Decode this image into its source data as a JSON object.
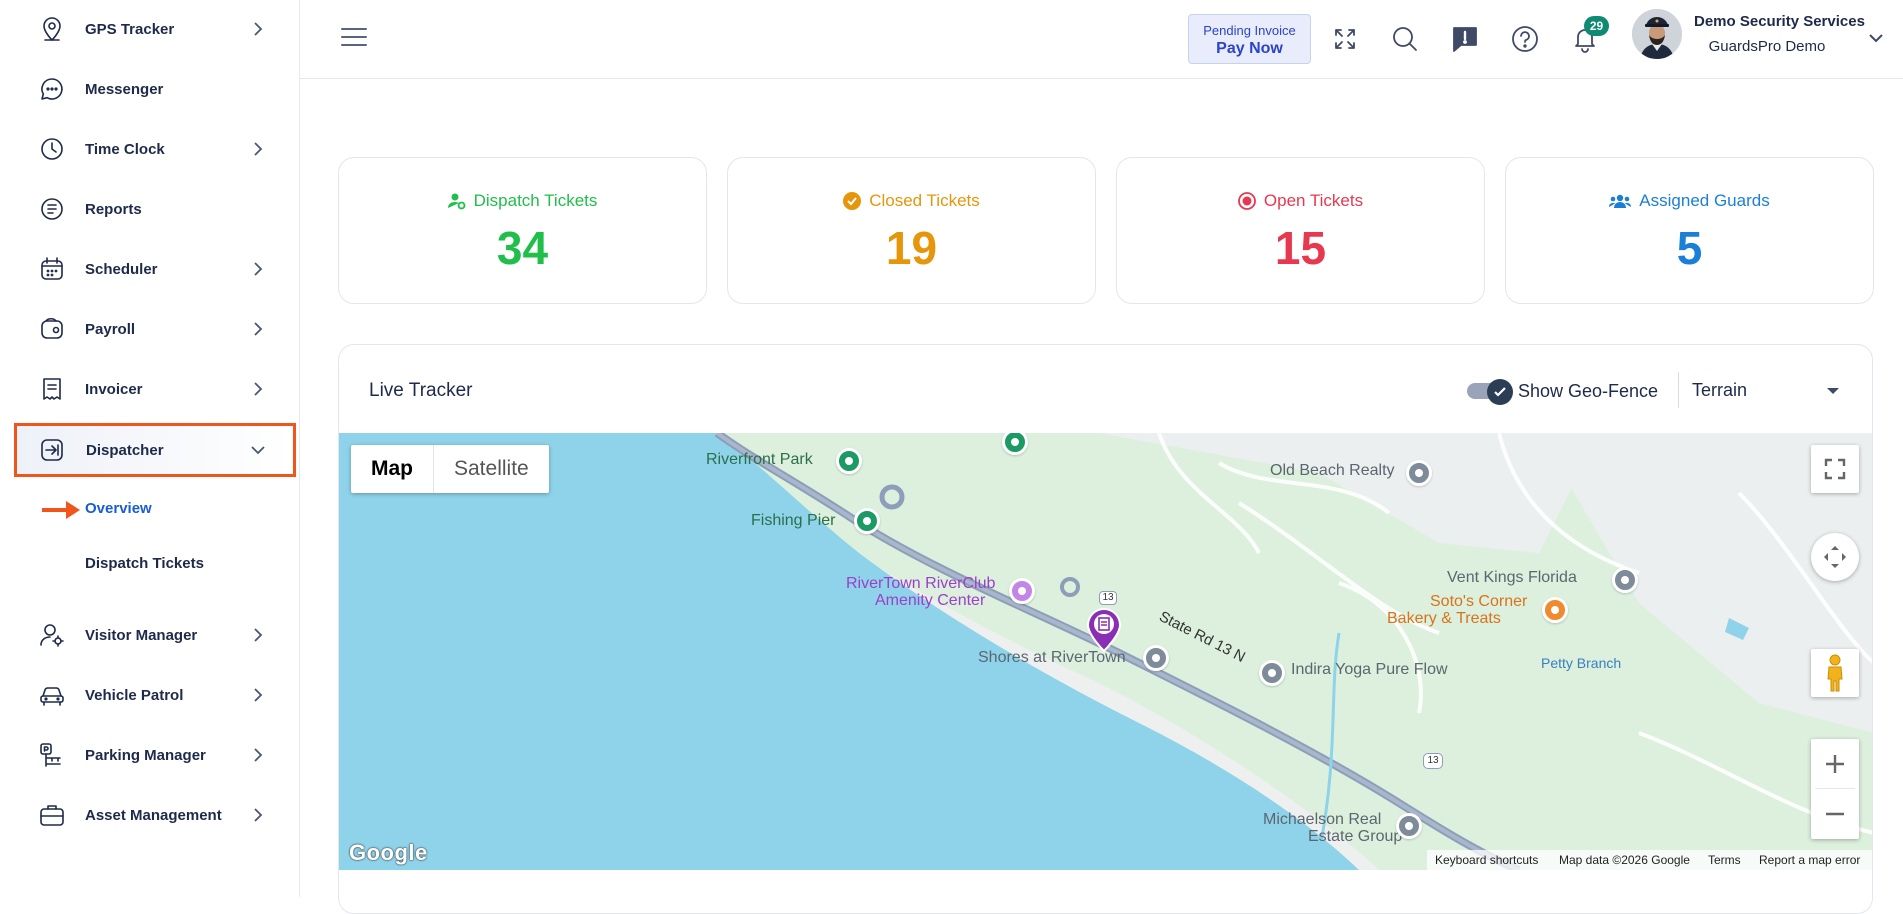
{
  "sidebar": {
    "items": [
      {
        "label": "GPS Tracker",
        "icon": "map-pin-icon"
      },
      {
        "label": "Messenger",
        "icon": "chat-bubble-icon"
      },
      {
        "label": "Time Clock",
        "icon": "clock-icon"
      },
      {
        "label": "Reports",
        "icon": "report-icon"
      },
      {
        "label": "Scheduler",
        "icon": "calendar-icon"
      },
      {
        "label": "Payroll",
        "icon": "wallet-icon"
      },
      {
        "label": "Invoicer",
        "icon": "receipt-icon"
      },
      {
        "label": "Dispatcher",
        "icon": "dispatch-icon"
      },
      {
        "label": "Visitor Manager",
        "icon": "user-gear-icon"
      },
      {
        "label": "Vehicle Patrol",
        "icon": "car-icon"
      },
      {
        "label": "Parking Manager",
        "icon": "parking-icon"
      },
      {
        "label": "Asset Management",
        "icon": "briefcase-icon"
      }
    ],
    "dispatcher_sub": [
      "Overview",
      "Dispatch Tickets"
    ],
    "active_color": "#f0561c",
    "current_sub_color": "#1a5cd6"
  },
  "header": {
    "pending_invoice": "Pending Invoice",
    "pay_now": "Pay Now",
    "notification_count": "29",
    "user_name": "Demo Security Services",
    "user_org": "GuardsPro Demo"
  },
  "stats": [
    {
      "label": "Dispatch Tickets",
      "value": "34",
      "color": "#1fbf4a",
      "icon": "user-gear-icon"
    },
    {
      "label": "Closed Tickets",
      "value": "19",
      "color": "#e5960b",
      "icon": "check-circle-icon"
    },
    {
      "label": "Open Tickets",
      "value": "15",
      "color": "#e8384f",
      "icon": "record-icon"
    },
    {
      "label": "Assigned Guards",
      "value": "5",
      "color": "#1a7fd6",
      "icon": "users-icon"
    }
  ],
  "tracker": {
    "title": "Live Tracker",
    "geofence_label": "Show Geo-Fence",
    "geofence_on": true,
    "map_type_selected": "Terrain",
    "map_tabs": [
      "Map",
      "Satellite"
    ],
    "labels": {
      "riverfront_park": "Riverfront Park",
      "fishing_pier": "Fishing Pier",
      "old_beach_realty": "Old Beach Realty",
      "rivertown_club_1": "RiverTown RiverClub",
      "rivertown_club_2": "Amenity Center",
      "vent_kings": "Vent Kings Florida",
      "sotos_1": "Soto's Corner",
      "sotos_2": "Bakery & Treats",
      "state_rd": "State Rd 13 N",
      "shores": "Shores at RiverTown",
      "indira": "Indira Yoga Pure Flow",
      "petty_branch": "Petty Branch",
      "michaelson_1": "Michaelson Real",
      "michaelson_2": "Estate Group",
      "route_13a": "13",
      "route_13b": "13"
    },
    "attribution": {
      "logo": "Google",
      "shortcuts": "Keyboard shortcuts",
      "mapdata": "Map data ©2026 Google",
      "terms": "Terms",
      "report": "Report a map error"
    }
  }
}
